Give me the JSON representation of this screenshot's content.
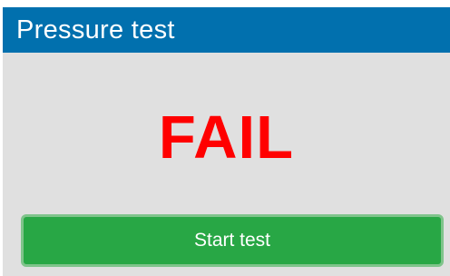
{
  "header": {
    "title": "Pressure test"
  },
  "main": {
    "status_text": "FAIL",
    "start_button_label": "Start test"
  },
  "colors": {
    "header_bg": "#0170ae",
    "panel_bg": "#e0e0e0",
    "status_fail": "#ff0000",
    "button_bg": "#28a745",
    "button_border": "#7fc48b"
  }
}
